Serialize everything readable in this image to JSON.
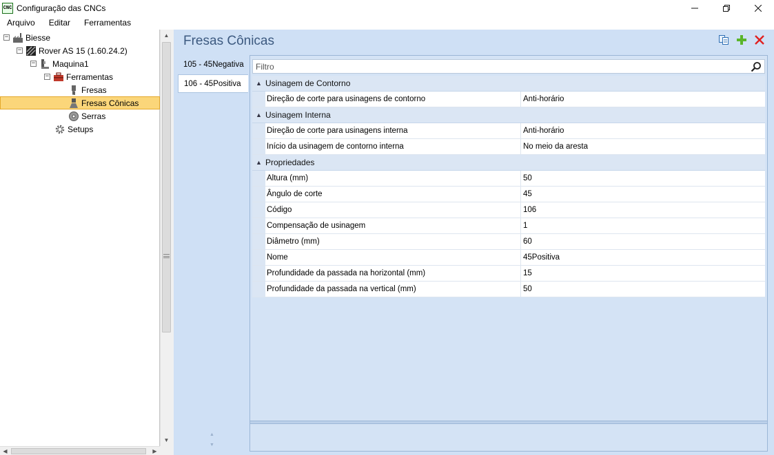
{
  "window": {
    "app_icon_text": "CNC",
    "title": "Configuração das CNCs",
    "controls": [
      "minimize-icon",
      "restore-icon",
      "close-icon"
    ]
  },
  "menu": {
    "items": [
      "Arquivo",
      "Editar",
      "Ferramentas"
    ]
  },
  "tree": {
    "nodes": [
      {
        "label": "Biesse",
        "icon": "factory-icon",
        "expander": "⊟",
        "level": 0
      },
      {
        "label": "Rover AS 15 (1.60.24.2)",
        "icon": "machine-icon",
        "expander": "⊟",
        "level": 1
      },
      {
        "label": "Maquina1",
        "icon": "spindle-icon",
        "expander": "⊟",
        "level": 2
      },
      {
        "label": "Ferramentas",
        "icon": "toolbox-icon",
        "expander": "⊟",
        "level": 3
      },
      {
        "label": "Fresas",
        "icon": "mill-icon",
        "level": 4
      },
      {
        "label": "Fresas Cônicas",
        "icon": "conical-mill-icon",
        "level": 4,
        "selected": true
      },
      {
        "label": "Serras",
        "icon": "saw-icon",
        "level": 4
      },
      {
        "label": "Setups",
        "icon": "gear-icon",
        "level": 3
      }
    ]
  },
  "main": {
    "title": "Fresas Cônicas",
    "tools": [
      "copy-icon",
      "add-icon",
      "delete-icon"
    ],
    "tabs": [
      {
        "label": "105 - 45Negativa",
        "active": false
      },
      {
        "label": "106 - 45Positiva",
        "active": true
      }
    ],
    "filter_placeholder": "Filtro"
  },
  "properties": [
    {
      "category": "Usinagem de Contorno",
      "rows": [
        {
          "name": "Direção de corte para usinagens de contorno",
          "value": "Anti-horário"
        }
      ]
    },
    {
      "category": "Usinagem Interna",
      "rows": [
        {
          "name": "Direção de corte para usinagens interna",
          "value": "Anti-horário"
        },
        {
          "name": "Início da usinagem de contorno interna",
          "value": "No meio da aresta"
        }
      ]
    },
    {
      "category": "Propriedades",
      "rows": [
        {
          "name": "Altura (mm)",
          "value": "50"
        },
        {
          "name": "Ângulo de corte",
          "value": "45"
        },
        {
          "name": "Código",
          "value": "106"
        },
        {
          "name": "Compensação de usinagem",
          "value": "1"
        },
        {
          "name": "Diâmetro (mm)",
          "value": "60"
        },
        {
          "name": "Nome",
          "value": "45Positiva"
        },
        {
          "name": "Profundidade da passada na horizontal (mm)",
          "value": "15"
        },
        {
          "name": "Profundidade da passada na vertical (mm)",
          "value": "50"
        }
      ]
    }
  ]
}
